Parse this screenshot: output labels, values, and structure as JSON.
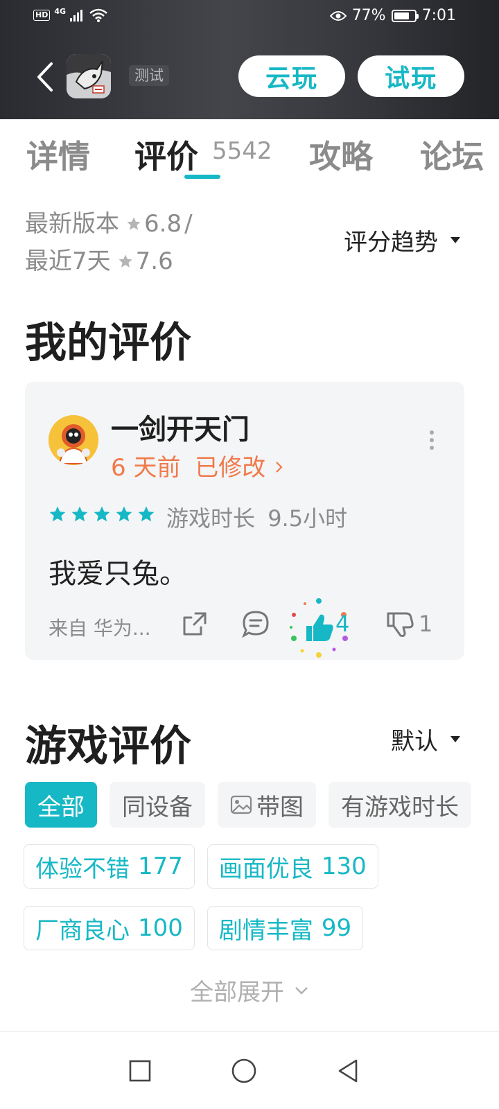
{
  "status_bar": {
    "hd": "HD",
    "network": "4G",
    "battery_percent": "77%",
    "battery_level": 0.77,
    "time": "7:01"
  },
  "header": {
    "back_icon": "chevron-left-icon",
    "app_icon": "game-app-icon",
    "test_badge": "测试",
    "cloud_play_label": "云玩",
    "try_play_label": "试玩",
    "accent_color": "#17b8c5"
  },
  "tabs": [
    {
      "label": "详情",
      "active": false
    },
    {
      "label": "评价",
      "active": true,
      "count": "5542"
    },
    {
      "label": "攻略",
      "active": false
    },
    {
      "label": "论坛",
      "active": false
    }
  ],
  "rating_summary": {
    "latest_label": "最新版本",
    "latest_score": "6.8",
    "separator": "/",
    "recent_label": "最近7天",
    "recent_score": "7.6",
    "trend_label": "评分趋势"
  },
  "my_review": {
    "section_title": "我的评价",
    "user_name": "一剑开天门",
    "time_ago": "6 天前",
    "modified": "已修改",
    "stars": 5,
    "playtime_label": "游戏时长",
    "playtime_value": "9.5小时",
    "text": "我爱只兔。",
    "from_device": "来自 华为...",
    "like_count": "4",
    "dislike_count": "1",
    "tag_color": "#f07a4a"
  },
  "game_reviews": {
    "section_title": "游戏评价",
    "sort_label": "默认",
    "filters": [
      "全部",
      "同设备",
      "带图",
      "有游戏时长"
    ],
    "tags": [
      {
        "label": "体验不错",
        "count": "177"
      },
      {
        "label": "画面优良",
        "count": "130"
      },
      {
        "label": "厂商良心",
        "count": "100"
      },
      {
        "label": "剧情丰富",
        "count": "99"
      }
    ],
    "expand_label": "全部展开"
  }
}
